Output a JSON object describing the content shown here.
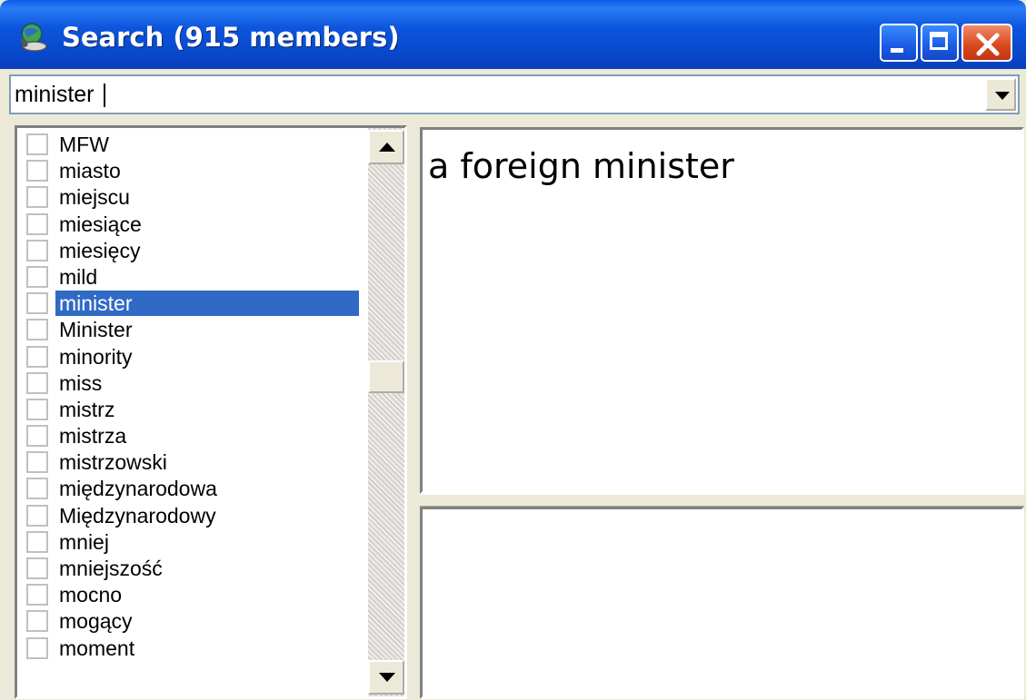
{
  "window": {
    "title": "Search (915 members)",
    "app_icon": "globe-search-icon",
    "controls": [
      "minimize-icon",
      "maximize-icon",
      "close-icon"
    ]
  },
  "search": {
    "value": "minister",
    "dropdown_icon": "chevron-down-icon"
  },
  "list": {
    "selected": "minister",
    "items": [
      {
        "label": "MFW",
        "checked": false
      },
      {
        "label": "miasto",
        "checked": false
      },
      {
        "label": "miejscu",
        "checked": false
      },
      {
        "label": "miesiące",
        "checked": false
      },
      {
        "label": "miesięcy",
        "checked": false
      },
      {
        "label": "mild",
        "checked": false
      },
      {
        "label": "minister",
        "checked": false
      },
      {
        "label": "Minister",
        "checked": false
      },
      {
        "label": "minority",
        "checked": false
      },
      {
        "label": "miss",
        "checked": false
      },
      {
        "label": "mistrz",
        "checked": false
      },
      {
        "label": "mistrza",
        "checked": false
      },
      {
        "label": "mistrzowski",
        "checked": false
      },
      {
        "label": "międzynarodowa",
        "checked": false
      },
      {
        "label": "Międzynarodowy",
        "checked": false
      },
      {
        "label": "mniej",
        "checked": false
      },
      {
        "label": "mniejszość",
        "checked": false
      },
      {
        "label": "mocno",
        "checked": false
      },
      {
        "label": "mogący",
        "checked": false
      },
      {
        "label": "moment",
        "checked": false
      }
    ]
  },
  "detail": {
    "definition": "a foreign minister",
    "notes": ""
  },
  "colors": {
    "titlebar": "#0a5ce8",
    "selection": "#316ac5",
    "face": "#ece9d8"
  }
}
